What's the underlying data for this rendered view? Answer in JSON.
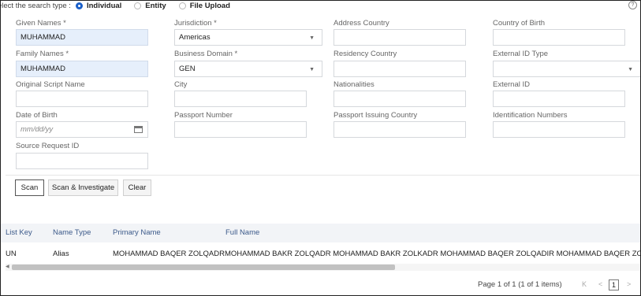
{
  "search_type": {
    "prompt": "elect the search type :",
    "options": [
      "Individual",
      "Entity",
      "File Upload"
    ],
    "selected": "Individual"
  },
  "form": {
    "given_names": {
      "label": "Given Names *",
      "value": "MUHAMMAD"
    },
    "family_names": {
      "label": "Family Names *",
      "value": "MUHAMMAD"
    },
    "original_script_name": {
      "label": "Original Script Name",
      "value": ""
    },
    "date_of_birth": {
      "label": "Date of Birth",
      "placeholder": "mm/dd/yy"
    },
    "source_request_id": {
      "label": "Source Request ID",
      "value": ""
    },
    "jurisdiction": {
      "label": "Jurisdiction *",
      "value": "Americas"
    },
    "business_domain": {
      "label": "Business Domain *",
      "value": "GEN"
    },
    "city": {
      "label": "City",
      "value": ""
    },
    "passport_number": {
      "label": "Passport Number",
      "value": ""
    },
    "address_country": {
      "label": "Address Country",
      "value": ""
    },
    "residency_country": {
      "label": "Residency Country",
      "value": ""
    },
    "nationalities": {
      "label": "Nationalities",
      "value": ""
    },
    "passport_issuing_country": {
      "label": "Passport Issuing Country",
      "value": ""
    },
    "country_of_birth": {
      "label": "Country of Birth",
      "value": ""
    },
    "external_id_type": {
      "label": "External ID Type",
      "value": ""
    },
    "external_id": {
      "label": "External ID",
      "value": ""
    },
    "identification_numbers": {
      "label": "Identification Numbers",
      "value": ""
    }
  },
  "buttons": {
    "scan": "Scan",
    "scan_investigate": "Scan & Investigate",
    "clear": "Clear"
  },
  "results": {
    "columns": [
      "List Key",
      "Name Type",
      "Primary Name",
      "Full Name"
    ],
    "rows": [
      [
        "UN",
        "Alias",
        "MOHAMMAD BAQER ZOLQADR",
        "MOHAMMAD BAKR ZOLQADR MOHAMMAD BAKR ZOLKADR MOHAMMAD BAQER ZOLQADIR MOHAMMAD BAQER ZOLQADER"
      ]
    ]
  },
  "pagination": {
    "summary": "Page  1  of 1  (1 of 1 items)",
    "first": "K",
    "prev": "<",
    "current": "1",
    "next": ">"
  },
  "icons": {
    "help": "help-circle-icon",
    "calendar": "calendar-icon",
    "dropdown": "caret-down-icon"
  },
  "colors": {
    "accent": "#1a5fc9",
    "filled_field": "#e6effb",
    "header_text": "#3c5a8a"
  }
}
